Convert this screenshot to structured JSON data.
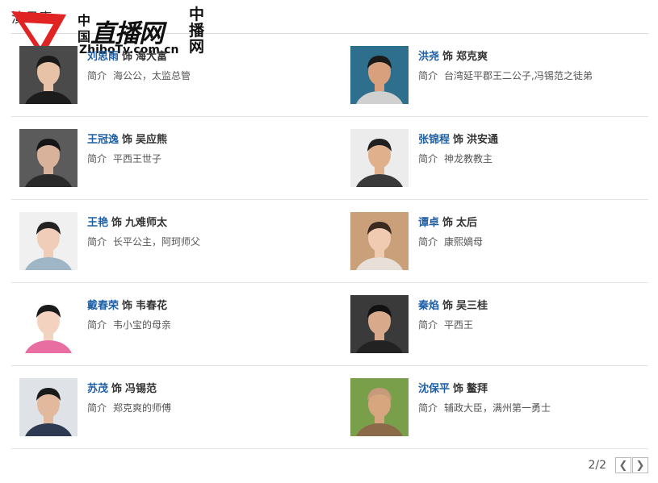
{
  "header": {
    "title": "演员表"
  },
  "watermark": {
    "left_text": "中国",
    "main_text": "直播网",
    "right_text": "中播网",
    "url": "ZhiboTv.com.cn"
  },
  "cast": [
    {
      "actor": "刘思雨",
      "role": "海大富",
      "intro_label": "简介",
      "intro": "海公公，太监总管",
      "photo_bg": "#4a4a4a",
      "skin": "#e8c2a6",
      "hair": "#1a1a1a",
      "shirt": "#1c1c1c"
    },
    {
      "actor": "洪尧",
      "role": "郑克爽",
      "intro_label": "简介",
      "intro": "台湾延平郡王二公子,冯锡范之徒弟",
      "photo_bg": "#2e6f8e",
      "skin": "#d9a07e",
      "hair": "#1a1a1a",
      "shirt": "#d0d0d0"
    },
    {
      "actor": "王冠逸",
      "role": "吴应熊",
      "intro_label": "简介",
      "intro": "平西王世子",
      "photo_bg": "#5b5b5b",
      "skin": "#d8b29a",
      "hair": "#161616",
      "shirt": "#2a2a2a"
    },
    {
      "actor": "张锦程",
      "role": "洪安通",
      "intro_label": "简介",
      "intro": "神龙教教主",
      "photo_bg": "#ececec",
      "skin": "#e0b08c",
      "hair": "#202020",
      "shirt": "#3a3a3a"
    },
    {
      "actor": "王艳",
      "role": "九难师太",
      "intro_label": "简介",
      "intro": "长平公主，阿珂师父",
      "photo_bg": "#f0f0f0",
      "skin": "#f0cdb8",
      "hair": "#222222",
      "shirt": "#9fb6c6"
    },
    {
      "actor": "谭卓",
      "role": "太后",
      "intro_label": "简介",
      "intro": "康熙嫡母",
      "photo_bg": "#c9a07a",
      "skin": "#f0cbb2",
      "hair": "#3a2a20",
      "shirt": "#e8e0d8"
    },
    {
      "actor": "戴春荣",
      "role": "韦春花",
      "intro_label": "简介",
      "intro": "韦小宝的母亲",
      "photo_bg": "#ffffff",
      "skin": "#f3d2c0",
      "hair": "#1a1a1a",
      "shirt": "#e86ea2"
    },
    {
      "actor": "秦焰",
      "role": "吴三桂",
      "intro_label": "简介",
      "intro": "平西王",
      "photo_bg": "#3a3a3a",
      "skin": "#d9a98c",
      "hair": "#111111",
      "shirt": "#222222"
    },
    {
      "actor": "苏茂",
      "role": "冯锡范",
      "intro_label": "简介",
      "intro": "郑克爽的师傅",
      "photo_bg": "#dfe3e7",
      "skin": "#e2b99c",
      "hair": "#1a1a1a",
      "shirt": "#2d3a52"
    },
    {
      "actor": "沈保平",
      "role": "鳌拜",
      "intro_label": "简介",
      "intro": "辅政大臣，满州第一勇士",
      "photo_bg": "#7a9f4a",
      "skin": "#d7a57e",
      "hair": "#c69a7a",
      "shirt": "#8b6a4a"
    }
  ],
  "role_separator": "饰",
  "pager": {
    "count": "2/2",
    "prev_icon": "chevron-left-icon",
    "next_icon": "chevron-right-icon"
  }
}
